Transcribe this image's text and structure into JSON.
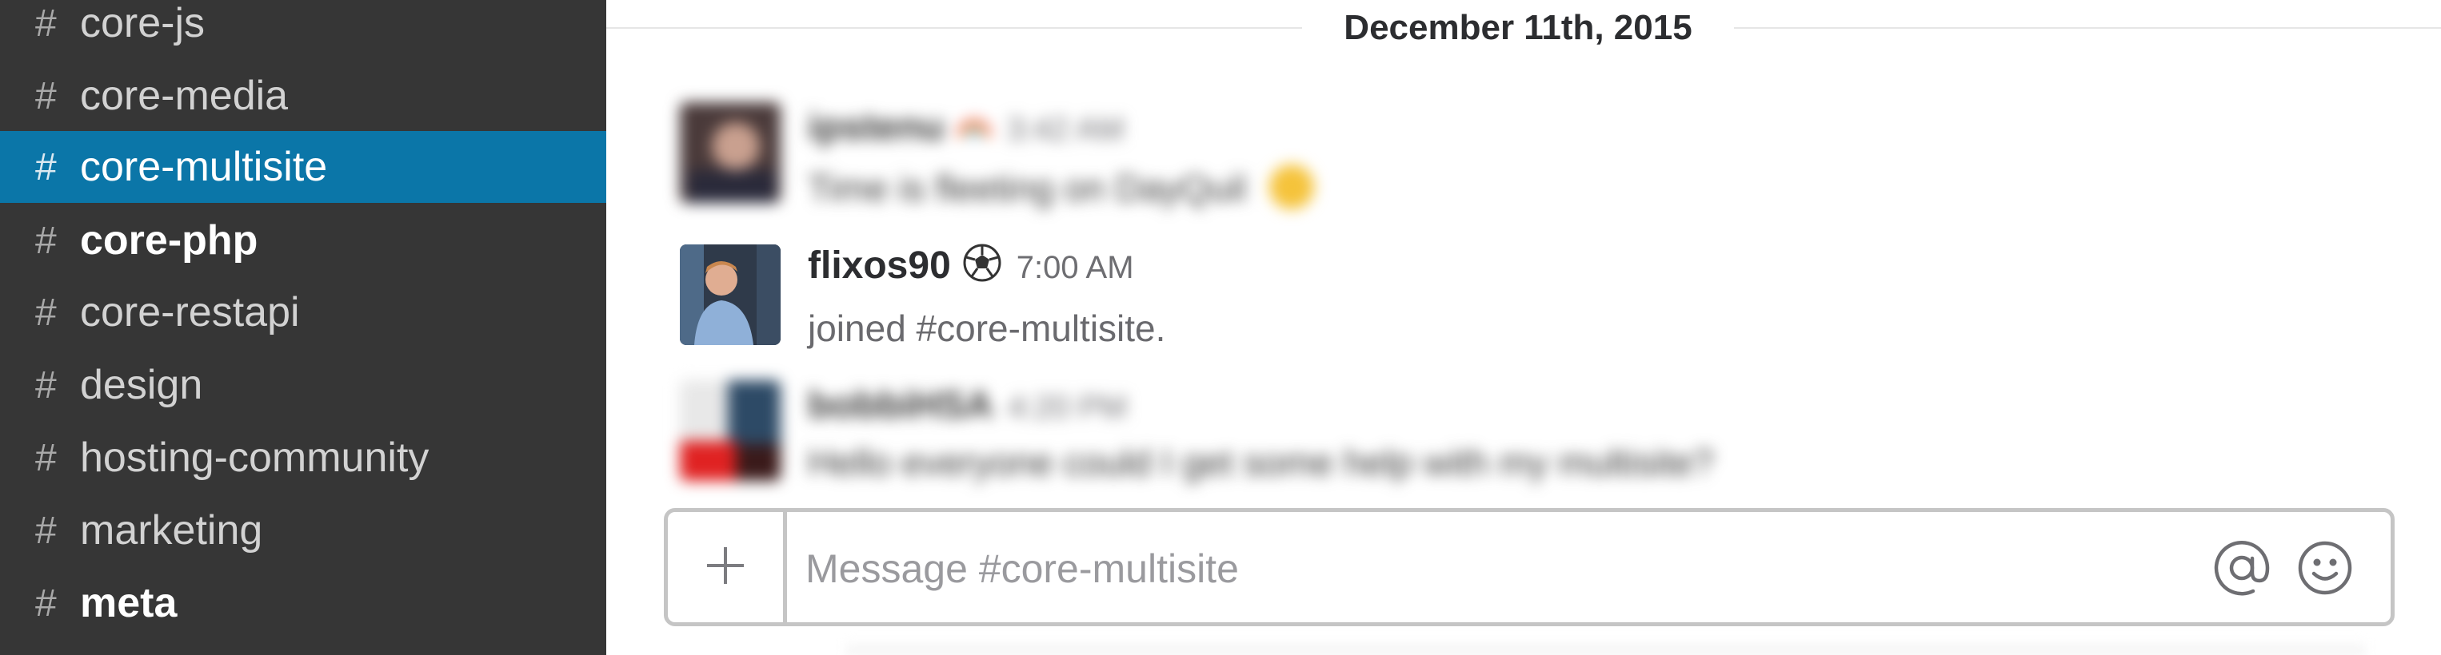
{
  "sidebar": {
    "channels": [
      {
        "hash": "#",
        "name": "core-js"
      },
      {
        "hash": "#",
        "name": "core-media"
      },
      {
        "hash": "#",
        "name": "core-multisite"
      },
      {
        "hash": "#",
        "name": "core-php"
      },
      {
        "hash": "#",
        "name": "core-restapi"
      },
      {
        "hash": "#",
        "name": "design"
      },
      {
        "hash": "#",
        "name": "hosting-community"
      },
      {
        "hash": "#",
        "name": "marketing"
      },
      {
        "hash": "#",
        "name": "meta"
      }
    ],
    "active_channel": "core-multisite",
    "unread_channels": [
      "core-php",
      "meta"
    ],
    "active_color": "#0b76a8",
    "background_color": "#363636"
  },
  "main": {
    "day_divider": "December 11th, 2015",
    "messages": [
      {
        "username": "ipstenu",
        "status_icon": "rainbow-icon",
        "time": "3:42 AM",
        "text": "Time is fleeting on DayQuil",
        "trailing_icon": "face-emoji-icon",
        "blurred": true
      },
      {
        "username": "flixos90",
        "status_icon": "soccer-ball-icon",
        "time": "7:00 AM",
        "text": "joined #core-multisite.",
        "blurred": false
      },
      {
        "username": "bobbiHSA",
        "time": "4:20 PM",
        "text": "Hello everyone could I get some help with my multisite?",
        "blurred": true
      }
    ]
  },
  "composer": {
    "placeholder": "Message #core-multisite",
    "value": "",
    "icons": [
      "plus-icon",
      "at-mention-icon",
      "emoji-picker-icon"
    ]
  }
}
